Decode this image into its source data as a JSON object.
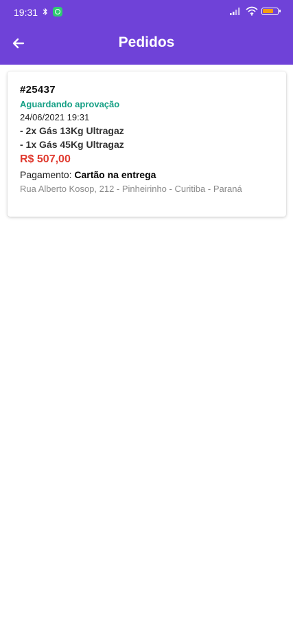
{
  "status_bar": {
    "time": "19:31"
  },
  "header": {
    "title": "Pedidos",
    "back_icon": "arrow-left-icon"
  },
  "colors": {
    "app_bar": "#6f42d8",
    "status_pending": "#16a085",
    "price": "#e03a2f"
  },
  "orders": [
    {
      "id": "#25437",
      "status": "Aguardando aprovação",
      "datetime": "24/06/2021 19:31",
      "items": [
        "- 2x Gás 13Kg Ultragaz",
        "- 1x Gás 45Kg Ultragaz"
      ],
      "total": "R$ 507,00",
      "payment_label": "Pagamento:",
      "payment_method": "Cartão na entrega",
      "address": "Rua Alberto Kosop, 212 - Pinheirinho - Curitiba - Paraná"
    }
  ]
}
